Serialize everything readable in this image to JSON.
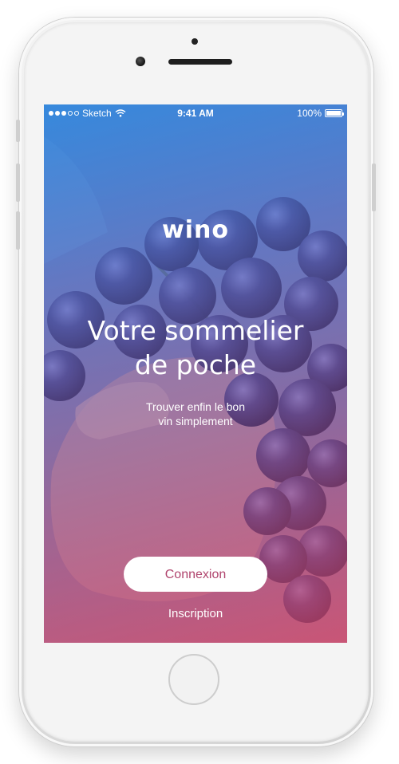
{
  "status_bar": {
    "carrier": "Sketch",
    "time": "9:41 AM",
    "battery": "100%",
    "battery_level": 1.0,
    "signal_filled": 3,
    "signal_total": 5
  },
  "app": {
    "logo": "wino",
    "headline_line1": "Votre sommelier",
    "headline_line2": "de poche",
    "subline_line1": "Trouver enfin le bon",
    "subline_line2": "vin simplement",
    "login_label": "Connexion",
    "signup_label": "Inscription"
  },
  "colors": {
    "accent": "#b0456e",
    "gradient_top": "#2c8ae2",
    "gradient_bottom": "#d64669"
  },
  "icons": {
    "signal": "signal-dots-icon",
    "wifi": "wifi-icon",
    "battery": "battery-icon",
    "background": "grapes-photo"
  }
}
